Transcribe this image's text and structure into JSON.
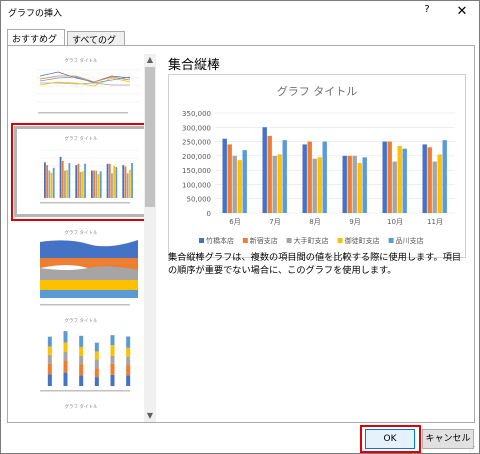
{
  "window": {
    "title": "グラフの挿入",
    "help_label": "?",
    "close_label": "✕"
  },
  "tabs": [
    {
      "label": "おすすめグラフ",
      "active": true
    },
    {
      "label": "すべてのグラフ",
      "active": false
    }
  ],
  "thumbnails": {
    "chart_title": "グラフ タイトル",
    "items": [
      {
        "type": "line",
        "selected": false
      },
      {
        "type": "clustered-column",
        "selected": true
      },
      {
        "type": "stacked-area",
        "selected": false
      },
      {
        "type": "stacked-column",
        "selected": false
      },
      {
        "type": "clustered-column",
        "selected": false
      }
    ]
  },
  "selected_chart": {
    "name": "集合縦棒",
    "description": "集合縦棒グラフは、複数の項目間の値を比較する際に使用します。項目の順序が重要でない場合に、このグラフを使用します。"
  },
  "buttons": {
    "ok_label": "OK",
    "cancel_label": "キャンセル"
  },
  "colors": {
    "series": [
      "#4472c4",
      "#ed7d31",
      "#a5a5a5",
      "#ffc000",
      "#5b9bd5"
    ],
    "accent_red": "#e00000",
    "ok_border": "#0078d7"
  },
  "chart_data": {
    "type": "bar",
    "title": "グラフ タイトル",
    "categories": [
      "6月",
      "7月",
      "8月",
      "9月",
      "10月",
      "11月"
    ],
    "series": [
      {
        "name": "竹橋本店",
        "values": [
          260000,
          300000,
          240000,
          200000,
          250000,
          240000
        ]
      },
      {
        "name": "新宿支店",
        "values": [
          240000,
          270000,
          250000,
          200000,
          250000,
          230000
        ]
      },
      {
        "name": "大手町支店",
        "values": [
          200000,
          200000,
          190000,
          200000,
          180000,
          180000
        ]
      },
      {
        "name": "御徒町支店",
        "values": [
          185000,
          205000,
          195000,
          175000,
          235000,
          205000
        ]
      },
      {
        "name": "品川支店",
        "values": [
          220000,
          255000,
          250000,
          195000,
          225000,
          255000
        ]
      }
    ],
    "ylim": [
      0,
      350000
    ],
    "yticks": [
      "0",
      "50,000",
      "100,000",
      "150,000",
      "200,000",
      "250,000",
      "300,000",
      "350,000"
    ],
    "grid": true,
    "legend": "bottom"
  }
}
